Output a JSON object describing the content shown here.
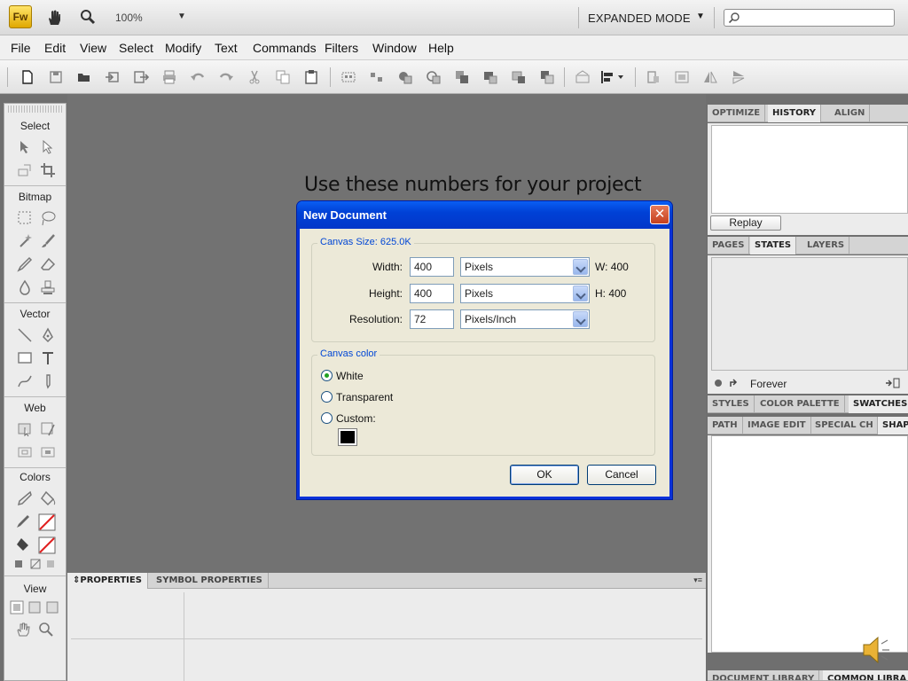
{
  "app": {
    "logo": "Fw",
    "zoom": "100%",
    "mode": "EXPANDED MODE"
  },
  "menu": [
    "File",
    "Edit",
    "View",
    "Select",
    "Modify",
    "Text",
    "Commands",
    "Filters",
    "Window",
    "Help"
  ],
  "tools": {
    "sections": [
      "Select",
      "Bitmap",
      "Vector",
      "Web",
      "Colors",
      "View"
    ]
  },
  "canvas": {
    "caption": "Use these numbers for your project"
  },
  "dialog": {
    "title": "New Document",
    "close": "✕",
    "canvas_size_label": "Canvas Size: 625.0K",
    "width_label": "Width:",
    "width_value": "400",
    "width_unit": "Pixels",
    "width_readout": "W: 400",
    "height_label": "Height:",
    "height_value": "400",
    "height_unit": "Pixels",
    "height_readout": "H: 400",
    "resolution_label": "Resolution:",
    "resolution_value": "72",
    "resolution_unit": "Pixels/Inch",
    "canvas_color_label": "Canvas color",
    "option_white": "White",
    "option_transparent": "Transparent",
    "option_custom": "Custom:",
    "custom_color": "#000000",
    "ok": "OK",
    "cancel": "Cancel"
  },
  "properties": {
    "tab_properties": "PROPERTIES",
    "tab_symbol": "SYMBOL PROPERTIES"
  },
  "right_panels": {
    "group1": [
      "OPTIMIZE",
      "HISTORY",
      "ALIGN"
    ],
    "replay": "Replay",
    "group2": [
      "PAGES",
      "STATES",
      "LAYERS"
    ],
    "forever": "Forever",
    "group3": [
      "STYLES",
      "COLOR PALETTE",
      "SWATCHES"
    ],
    "group4": [
      "PATH",
      "IMAGE EDIT",
      "SPECIAL CH",
      "SHAP"
    ],
    "group5": [
      "DOCUMENT LIBRARY",
      "COMMON LIBRA"
    ]
  }
}
